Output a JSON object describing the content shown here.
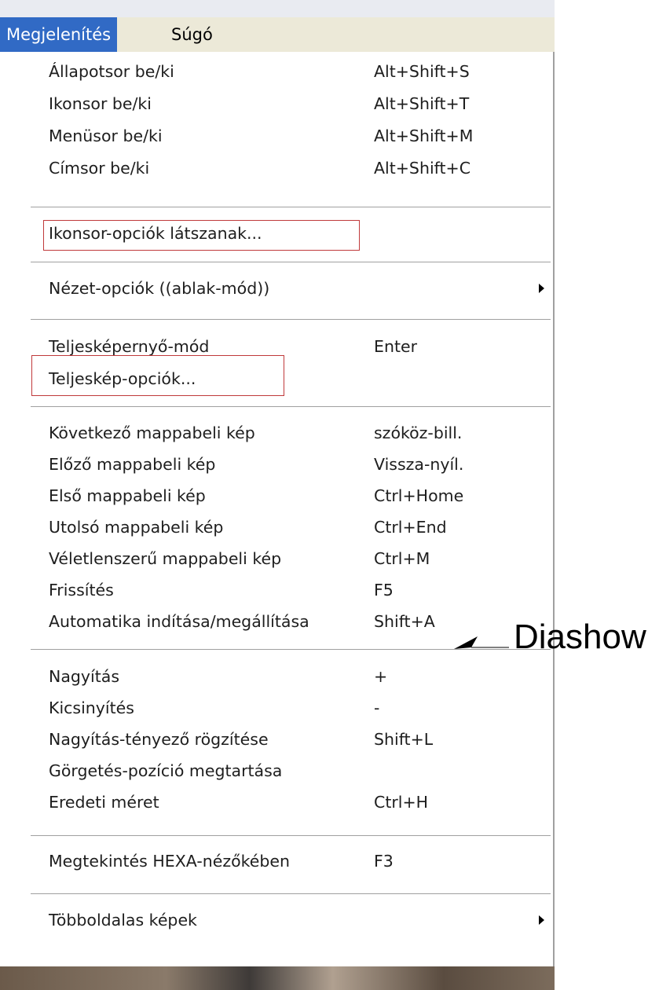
{
  "menubar": {
    "view_label": "Megjelenítés",
    "help_label": "Súgó"
  },
  "menu": {
    "toggles": [
      {
        "label": "Állapotsor be/ki",
        "shortcut": "Alt+Shift+S"
      },
      {
        "label": "Ikonsor be/ki",
        "shortcut": "Alt+Shift+T"
      },
      {
        "label": "Menüsor be/ki",
        "shortcut": "Alt+Shift+M"
      },
      {
        "label": "Címsor be/ki",
        "shortcut": "Alt+Shift+C"
      }
    ],
    "toolbar_options": {
      "label": "Ikonsor-opciók látszanak..."
    },
    "view_options": {
      "label": "Nézet-opciók ((ablak-mód))"
    },
    "fullscreen": {
      "label": "Teljesképernyő-mód",
      "shortcut": "Enter"
    },
    "fullscreen_options": {
      "label": "Teljeskép-opciók..."
    },
    "navigation": [
      {
        "label": "Következő mappabeli kép",
        "shortcut": "szóköz-bill."
      },
      {
        "label": "Előző mappabeli kép",
        "shortcut": "Vissza-nyíl."
      },
      {
        "label": "Első mappabeli kép",
        "shortcut": "Ctrl+Home"
      },
      {
        "label": "Utolsó mappabeli kép",
        "shortcut": "Ctrl+End"
      },
      {
        "label": "Véletlenszerű mappabeli kép",
        "shortcut": "Ctrl+M"
      },
      {
        "label": "Frissítés",
        "shortcut": "F5"
      },
      {
        "label": "Automatika indítása/megállítása",
        "shortcut": "Shift+A"
      }
    ],
    "zoom": [
      {
        "label": "Nagyítás",
        "shortcut": "+"
      },
      {
        "label": "Kicsinyítés",
        "shortcut": "-"
      },
      {
        "label": "Nagyítás-tényező rögzítése",
        "shortcut": "Shift+L"
      },
      {
        "label": "Görgetés-pozíció megtartása",
        "shortcut": ""
      },
      {
        "label": "Eredeti méret",
        "shortcut": "Ctrl+H"
      }
    ],
    "hex_view": {
      "label": "Megtekintés HEXA-nézőkében",
      "shortcut": "F3"
    },
    "multipage": {
      "label": "Többoldalas képek"
    }
  },
  "annotation": {
    "label": "Diashow"
  },
  "colors": {
    "menu_highlight": "#316ac5",
    "callout_box": "#c0393b"
  }
}
